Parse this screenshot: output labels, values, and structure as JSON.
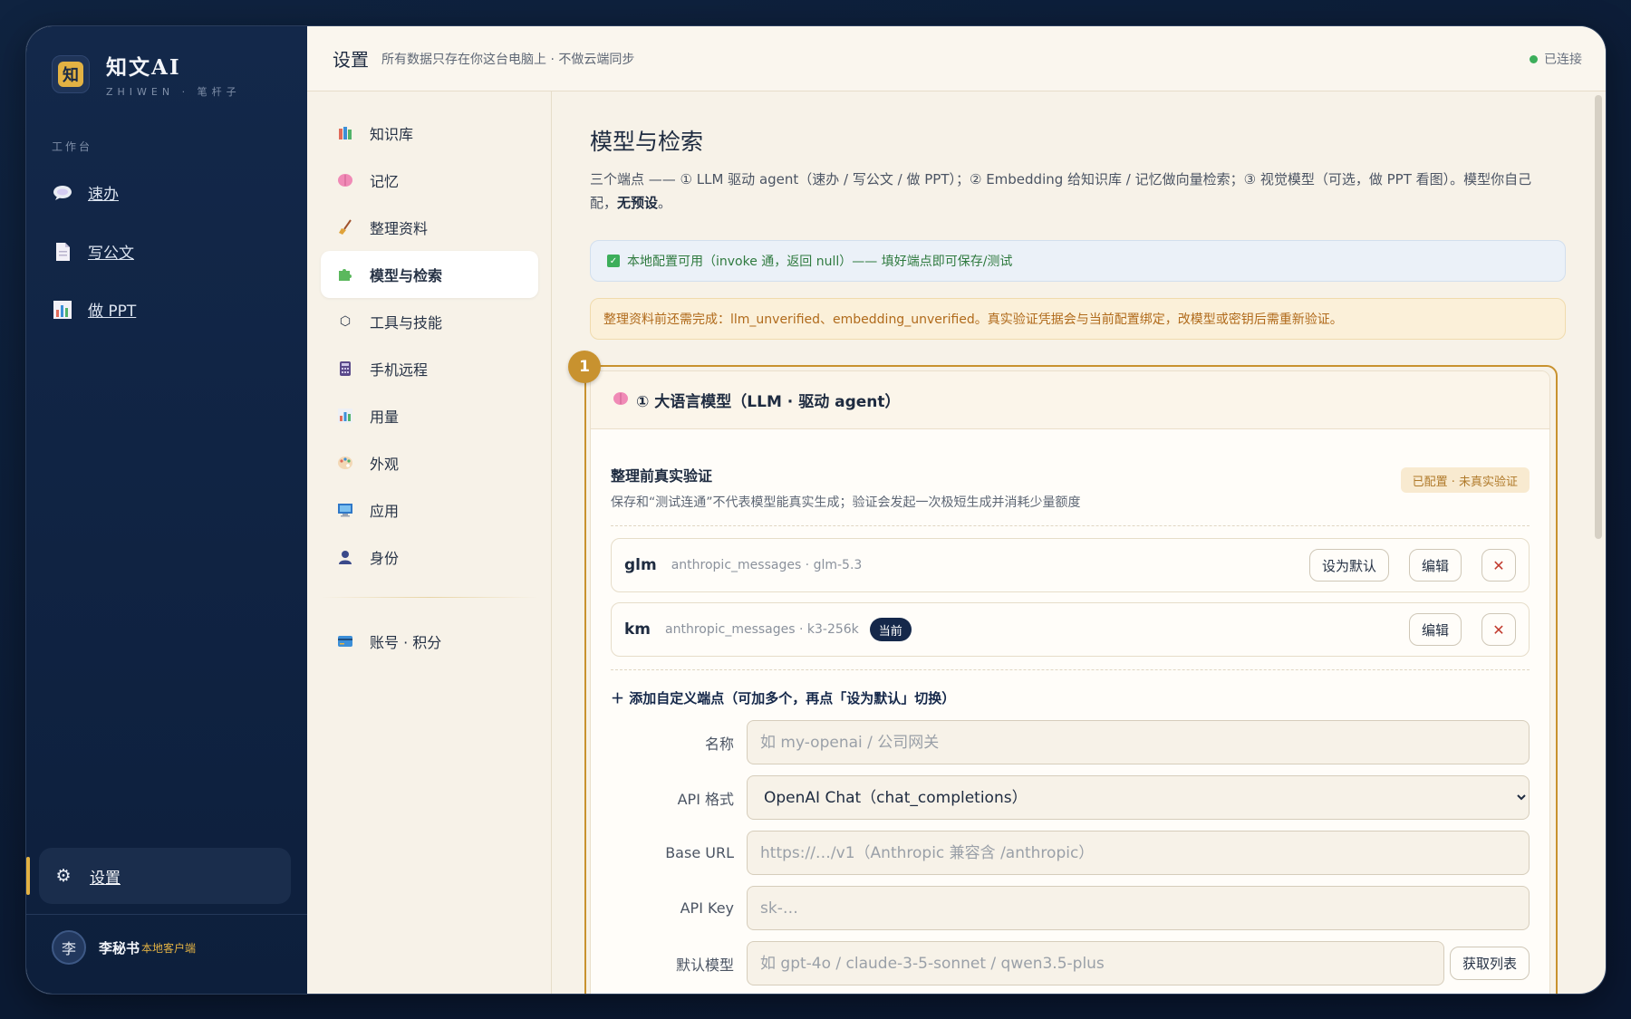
{
  "sidebar": {
    "brand_title": "知文AI",
    "brand_sub": "ZHIWEN · 笔杆子",
    "logo_char": "知",
    "section_label": "工作台",
    "items": [
      {
        "label": "速办",
        "icon": "speech-bubble-icon"
      },
      {
        "label": "写公文",
        "icon": "document-icon"
      },
      {
        "label": "做 PPT",
        "icon": "bar-chart-icon"
      }
    ],
    "settings_label": "设置",
    "user": {
      "avatar_char": "李",
      "name": "李秘书",
      "tag": "本地客户端"
    }
  },
  "topbar": {
    "title": "设置",
    "subtitle": "所有数据只存在你这台电脑上 · 不做云端同步",
    "status": "已连接",
    "status_color": "#3cae5a"
  },
  "subnav": {
    "items": [
      {
        "label": "知识库",
        "icon": "books-icon"
      },
      {
        "label": "记忆",
        "icon": "brain-icon"
      },
      {
        "label": "整理资料",
        "icon": "broom-icon"
      },
      {
        "label": "模型与检索",
        "icon": "puzzle-icon",
        "active": true
      },
      {
        "label": "工具与技能",
        "icon": "hexagon-icon"
      },
      {
        "label": "手机远程",
        "icon": "calculator-icon"
      },
      {
        "label": "用量",
        "icon": "chart-icon"
      },
      {
        "label": "外观",
        "icon": "palette-icon"
      },
      {
        "label": "应用",
        "icon": "monitor-icon"
      },
      {
        "label": "身份",
        "icon": "person-icon"
      }
    ],
    "account_label": "账号 · 积分"
  },
  "content": {
    "title": "模型与检索",
    "desc_main": "三个端点 —— ① LLM 驱动 agent（速办 / 写公文 / 做 PPT）；② Embedding 给知识库 / 记忆做向量检索；③ 视觉模型（可选，做 PPT 看图）。模型你自己配，",
    "desc_bold": "无预设",
    "desc_end": "。",
    "alert_ok": "本地配置可用（invoke 通，返回 null）—— 填好端点即可保存/测试",
    "alert_warn": "整理资料前还需完成：llm_unverified、embedding_unverified。真实验证凭据会与当前配置绑定，改模型或密钥后需重新验证。",
    "step_number": "1",
    "card": {
      "title": "① 大语言模型（LLM · 驱动 agent）",
      "verify_title": "整理前真实验证",
      "verify_desc": "保存和“测试连通”不代表模型能真实生成；验证会发起一次极短生成并消耗少量额度",
      "verify_badge": "已配置 · 未真实验证",
      "endpoints": [
        {
          "name": "glm",
          "meta": "anthropic_messages · glm-5.3",
          "set_default": "设为默认",
          "edit": "编辑",
          "current": false
        },
        {
          "name": "km",
          "meta": "anthropic_messages · k3-256k",
          "current_label": "当前",
          "edit": "编辑",
          "current": true
        }
      ],
      "add_link": "＋ 添加自定义端点（可加多个，再点「设为默认」切换）",
      "form": {
        "name_label": "名称",
        "name_placeholder": "如 my-openai / 公司网关",
        "format_label": "API 格式",
        "format_value": "OpenAI Chat（chat_completions）",
        "base_label": "Base URL",
        "base_placeholder": "https://…/v1（Anthropic 兼容含 /anthropic）",
        "key_label": "API Key",
        "key_placeholder": "sk-…",
        "model_label": "默认模型",
        "model_placeholder": "如 gpt-4o / claude-3-5-sonnet / qwen3.5-plus",
        "fetch_label": "获取列表"
      }
    }
  }
}
